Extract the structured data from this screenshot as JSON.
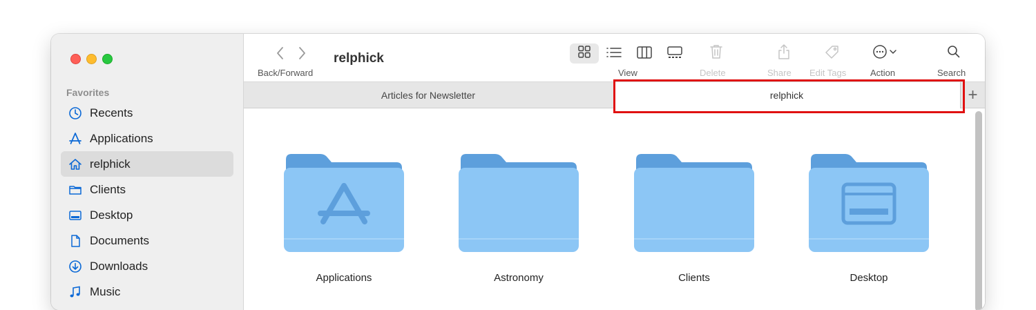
{
  "sidebar": {
    "section_title": "Favorites",
    "items": [
      {
        "label": "Recents",
        "icon": "clock-icon"
      },
      {
        "label": "Applications",
        "icon": "applications-icon"
      },
      {
        "label": "relphick",
        "icon": "home-icon",
        "selected": true
      },
      {
        "label": "Clients",
        "icon": "folder-icon"
      },
      {
        "label": "Desktop",
        "icon": "desktop-icon"
      },
      {
        "label": "Documents",
        "icon": "document-icon"
      },
      {
        "label": "Downloads",
        "icon": "download-icon"
      },
      {
        "label": "Music",
        "icon": "music-icon"
      }
    ]
  },
  "toolbar": {
    "back_forward_label": "Back/Forward",
    "title": "relphick",
    "view_label": "View",
    "delete_label": "Delete",
    "share_label": "Share",
    "edit_tags_label": "Edit Tags",
    "action_label": "Action",
    "search_label": "Search"
  },
  "tabs": [
    {
      "label": "Articles for Newsletter",
      "active": false
    },
    {
      "label": "relphick",
      "active": true
    }
  ],
  "tab_add_label": "+",
  "folders": [
    {
      "name": "Applications",
      "emblem": "applications-icon"
    },
    {
      "name": "Astronomy",
      "emblem": ""
    },
    {
      "name": "Clients",
      "emblem": ""
    },
    {
      "name": "Desktop",
      "emblem": "desktop-icon"
    }
  ],
  "colors": {
    "accent": "#0a68d6",
    "highlight": "#e01010",
    "folder_back": "#5d9fdc",
    "folder_front": "#8cc6f5"
  }
}
